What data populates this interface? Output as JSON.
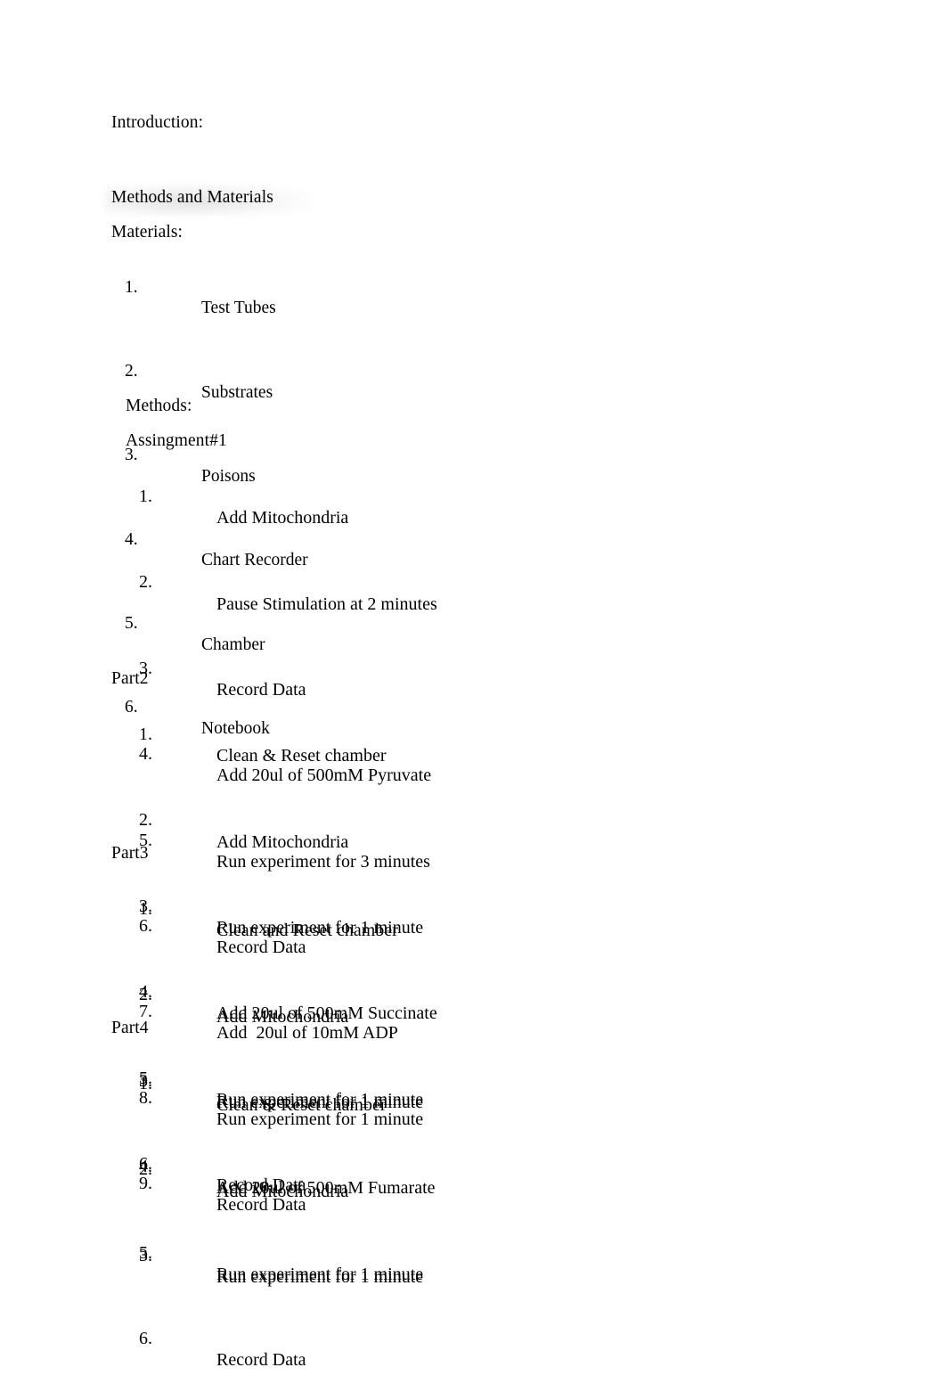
{
  "document": {
    "sections": {
      "introduction_heading": "Introduction:",
      "methods_and_materials_heading": "Methods and Materials",
      "materials_label": "Materials:",
      "methods_label": "Methods:",
      "assignment1_label": "Assingment#1",
      "part2_label": "Part2",
      "part3_label": "Part3",
      "part4_label": "Part4"
    },
    "materials_list": [
      {
        "number": "1.",
        "text": "Test Tubes"
      },
      {
        "number": "2.",
        "text": "Substrates"
      },
      {
        "number": "3.",
        "text": "Poisons"
      },
      {
        "number": "4.",
        "text": "Chart Recorder"
      },
      {
        "number": "5.",
        "text": "Chamber"
      },
      {
        "number": "6.",
        "text": "Notebook"
      }
    ],
    "assignment1_steps": [
      {
        "number": "1.",
        "text": "Add Mitochondria"
      },
      {
        "number": "2.",
        "text": "Pause Stimulation at 2 minutes"
      },
      {
        "number": "3.",
        "text": "Record Data"
      },
      {
        "number": "4.",
        "text": "Add 20ul of 500mM Pyruvate"
      },
      {
        "number": "5.",
        "text": "Run experiment for 3 minutes"
      },
      {
        "number": "6.",
        "text": "Record Data"
      },
      {
        "number": "7.",
        "text": "Add  20ul of 10mM ADP"
      },
      {
        "number": "8.",
        "text": "Run experiment for 1 minute"
      },
      {
        "number": "9.",
        "text": "Record Data"
      }
    ],
    "part2_steps": [
      {
        "number": "1.",
        "text": "Clean & Reset chamber"
      },
      {
        "number": "2.",
        "text": "Add Mitochondria"
      },
      {
        "number": "3.",
        "text": "Run experiment for 1 minute"
      },
      {
        "number": "4.",
        "text": "Add 20ul of 500mM Succinate"
      },
      {
        "number": "5.",
        "text": "Run experiment for 1 minute"
      },
      {
        "number": "6.",
        "text": "Record Data"
      }
    ],
    "part3_steps": [
      {
        "number": "1.",
        "text": "Clean and Reset chamber"
      },
      {
        "number": "2.",
        "text": "Add Mitochondria"
      },
      {
        "number": "3.",
        "text": "Run experiment for 1 minute"
      },
      {
        "number": "4.",
        "text": "Add 20ul of 500mM Fumarate"
      },
      {
        "number": "5.",
        "text": "Run experiment for 1 minute"
      },
      {
        "number": "6.",
        "text": "Record Data"
      }
    ],
    "part4_steps": [
      {
        "number": "1.",
        "text": "Clean & Reset chamber"
      },
      {
        "number": "2.",
        "text": "Add Mitochondria"
      },
      {
        "number": "3.",
        "text": "Run experiment for 1 minute"
      }
    ],
    "colors": {
      "page_background": "#ffffff",
      "text": "#000000",
      "heading_shadow": "#787878"
    }
  }
}
